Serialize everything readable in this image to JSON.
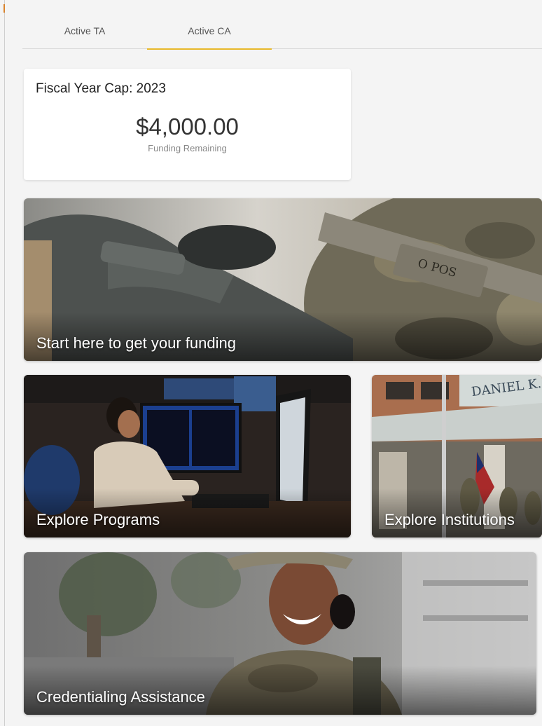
{
  "colors": {
    "accent": "#e8b82a",
    "left_accent": "#d9822b"
  },
  "tabs": [
    {
      "label": "Active TA",
      "active": false
    },
    {
      "label": "Active CA",
      "active": true
    }
  ],
  "funding": {
    "title": "Fiscal Year Cap: 2023",
    "amount": "$4,000.00",
    "subtitle": "Funding Remaining"
  },
  "tiles": {
    "hero": {
      "label": "Start here to get your funding",
      "nametape": "O POS"
    },
    "programs": {
      "label": "Explore Programs"
    },
    "institutions": {
      "label": "Explore Institutions",
      "building_sign": "DANIEL K."
    },
    "credential": {
      "label": "Credentialing Assistance"
    }
  }
}
